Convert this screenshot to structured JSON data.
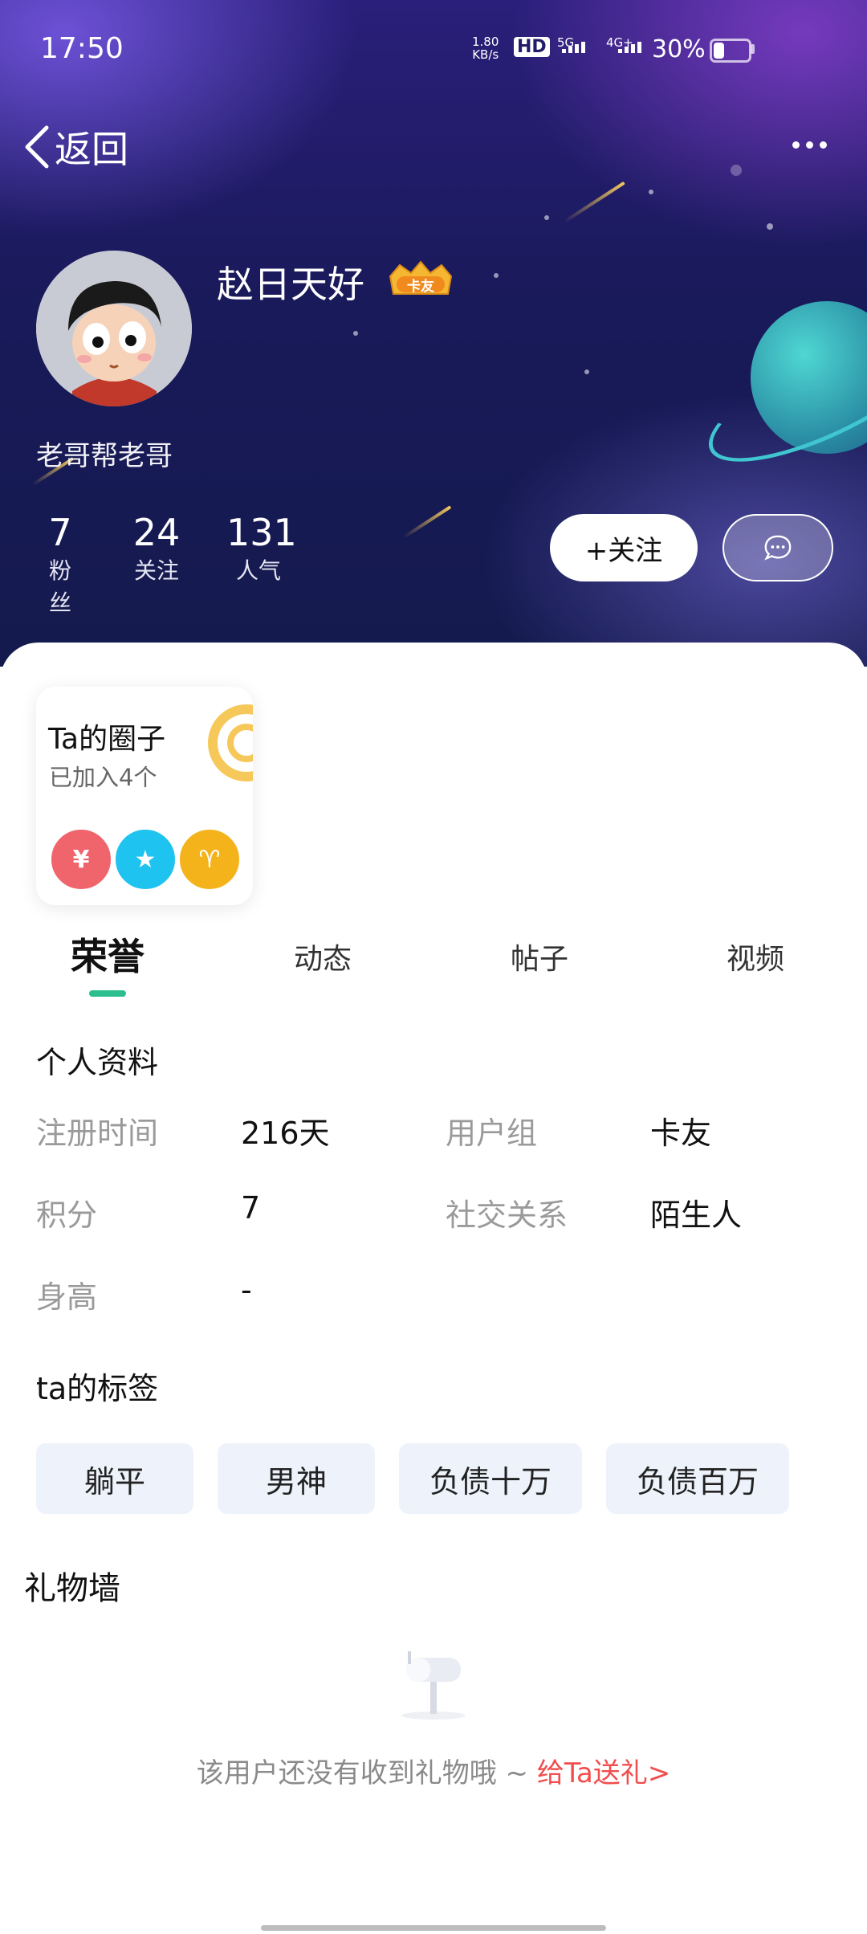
{
  "status_bar": {
    "time": "17:50",
    "net_speed_value": "1.80",
    "net_speed_unit": "KB/s",
    "hd_label": "HD",
    "signal_1": "5G",
    "signal_2": "4G+",
    "battery": "30%",
    "battery_level": 0.3
  },
  "nav": {
    "back_label": "返回",
    "more_icon": "more-dots-icon"
  },
  "profile": {
    "name": "赵日天好",
    "badge": "卡友",
    "signature": "老哥帮老哥",
    "stats": [
      {
        "value": "7",
        "label": "粉丝"
      },
      {
        "value": "24",
        "label": "关注"
      },
      {
        "value": "131",
        "label": "人气"
      }
    ],
    "follow_label": "+关注",
    "message_icon": "chat-bubble-icon"
  },
  "circles": {
    "title": "Ta的圈子",
    "subtitle": "已加入4个",
    "icons": [
      {
        "name": "coin-icon",
        "color": "#f0646c",
        "glyph": "¥"
      },
      {
        "name": "folder-star-icon",
        "color": "#1fc3ef",
        "glyph": "★"
      },
      {
        "name": "aries-icon",
        "color": "#f5b31b",
        "glyph": "♈"
      }
    ]
  },
  "tabs": [
    {
      "label": "荣誉",
      "active": true
    },
    {
      "label": "动态",
      "active": false
    },
    {
      "label": "帖子",
      "active": false
    },
    {
      "label": "视频",
      "active": false
    }
  ],
  "profile_info": {
    "title": "个人资料",
    "rows": [
      {
        "label1": "注册时间",
        "value1": "216天",
        "label2": "用户组",
        "value2": "卡友"
      },
      {
        "label1": "积分",
        "value1": "7",
        "label2": "社交关系",
        "value2": "陌生人"
      },
      {
        "label1": "身高",
        "value1": "-"
      }
    ]
  },
  "tags": {
    "title": "ta的标签",
    "items": [
      "躺平",
      "男神",
      "负债十万",
      "负债百万"
    ]
  },
  "gift_wall": {
    "title": "礼物墙",
    "empty_text": "该用户还没有收到礼物哦 ~ ",
    "link_text": "给Ta送礼>"
  },
  "colors": {
    "accent_green": "#2bbf8f",
    "link_red": "#f24d4d",
    "badge_gold": "#f6b93b"
  }
}
